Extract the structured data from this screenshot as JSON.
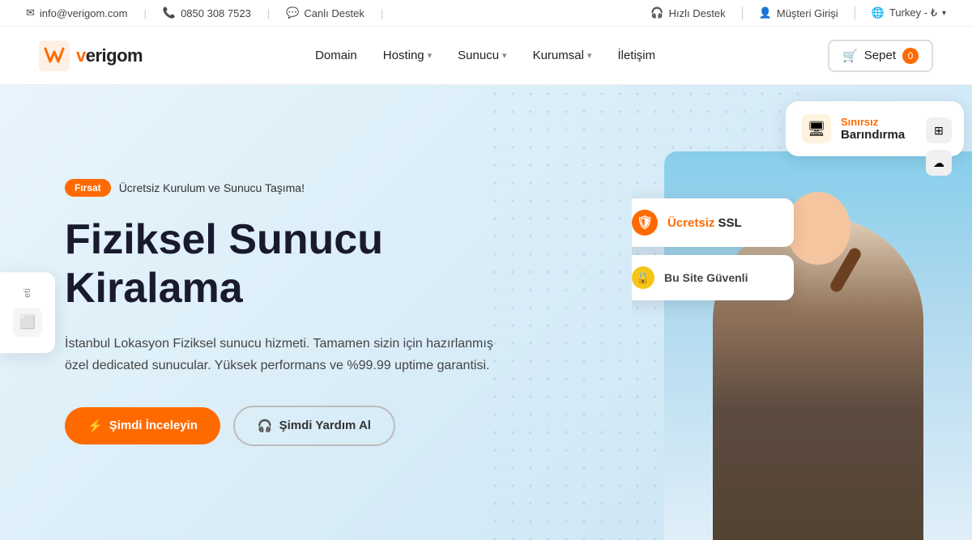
{
  "topbar": {
    "email": "info@verigom.com",
    "phone": "0850 308 7523",
    "live_support": "Canlı Destek",
    "quick_support": "Hızlı Destek",
    "customer_login": "Müşteri Girişi",
    "country": "Turkey - ₺",
    "email_icon": "✉",
    "phone_icon": "📞",
    "chat_icon": "💬",
    "headset_icon": "🎧",
    "user_icon": "👤",
    "flag_icon": "🌐"
  },
  "navbar": {
    "logo_text_v": "v",
    "logo_text_brand": "erigom",
    "links": [
      {
        "label": "Domain",
        "has_dropdown": false
      },
      {
        "label": "Hosting",
        "has_dropdown": true
      },
      {
        "label": "Sunucu",
        "has_dropdown": true
      },
      {
        "label": "Kurumsal",
        "has_dropdown": true
      },
      {
        "label": "İletişim",
        "has_dropdown": false
      }
    ],
    "cart_label": "Sepet",
    "cart_count": "0"
  },
  "hero": {
    "badge_label": "Fırsat",
    "badge_text": "Ücretsiz Kurulum ve Sunucu Taşıma!",
    "title": "Fiziksel Sunucu Kiralama",
    "description": "İstanbul Lokasyon Fiziksel sunucu hizmeti. Tamamen sizin için hazırlanmış özel dedicated sunucular. Yüksek performans ve %99.99 uptime garantisi.",
    "btn_primary": "Şimdi İnceleyin",
    "btn_secondary": "Şimdi Yardım Al",
    "ssl_label": "Ücretsiz",
    "ssl_suffix": "SSL",
    "safe_label": "Bu Site Güvenli",
    "panel_top": "Sınırsız",
    "panel_main": "Barındırma",
    "side_label": "eti"
  }
}
